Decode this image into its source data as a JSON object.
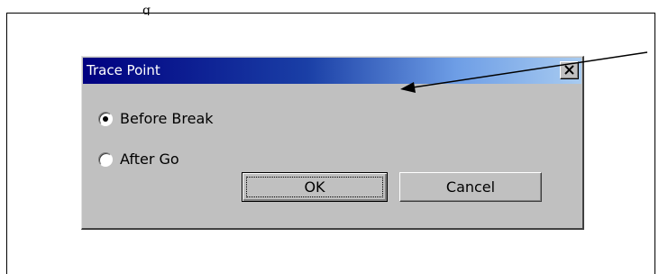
{
  "page": {
    "top_fragment": "g"
  },
  "dialog": {
    "title": "Trace Point",
    "close_glyph": "✕",
    "options": [
      {
        "label": "Before Break",
        "selected": true
      },
      {
        "label": "After Go",
        "selected": false
      }
    ],
    "ok_label": "OK",
    "cancel_label": "Cancel"
  },
  "colors": {
    "titlebar_start": "#000080",
    "titlebar_end": "#a8cbf0",
    "dialog_face": "#c0c0c0",
    "arrow": "#000000"
  },
  "icons": {
    "close": "close-icon",
    "arrow": "pointer-arrow"
  }
}
